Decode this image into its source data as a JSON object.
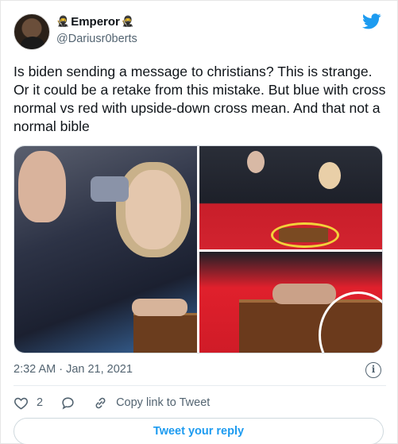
{
  "author": {
    "display_name": "Emperor",
    "handle": "@Dariusr0berts",
    "name_emoji": "🥷"
  },
  "tweet": {
    "text": "Is biden sending a message to christians? This is strange. Or it could be a retake from this mistake. But blue with cross normal vs red with upside-down cross mean. And that not a normal bible",
    "timestamp": "2:32 AM · Jan 21, 2021"
  },
  "engagement": {
    "likes": "2",
    "copy_link_label": "Copy link to Tweet"
  },
  "reply": {
    "button_label": "Tweet your reply"
  },
  "icons": {
    "brand": "twitter-bird-icon",
    "info": "info-icon",
    "like": "heart-icon",
    "reply": "reply-bubble-icon",
    "link": "link-icon"
  },
  "colors": {
    "accent": "#1d9bf0",
    "secondary_text": "#536471",
    "annotation_yellow": "#f2d13a",
    "annotation_white": "#ffffff"
  }
}
